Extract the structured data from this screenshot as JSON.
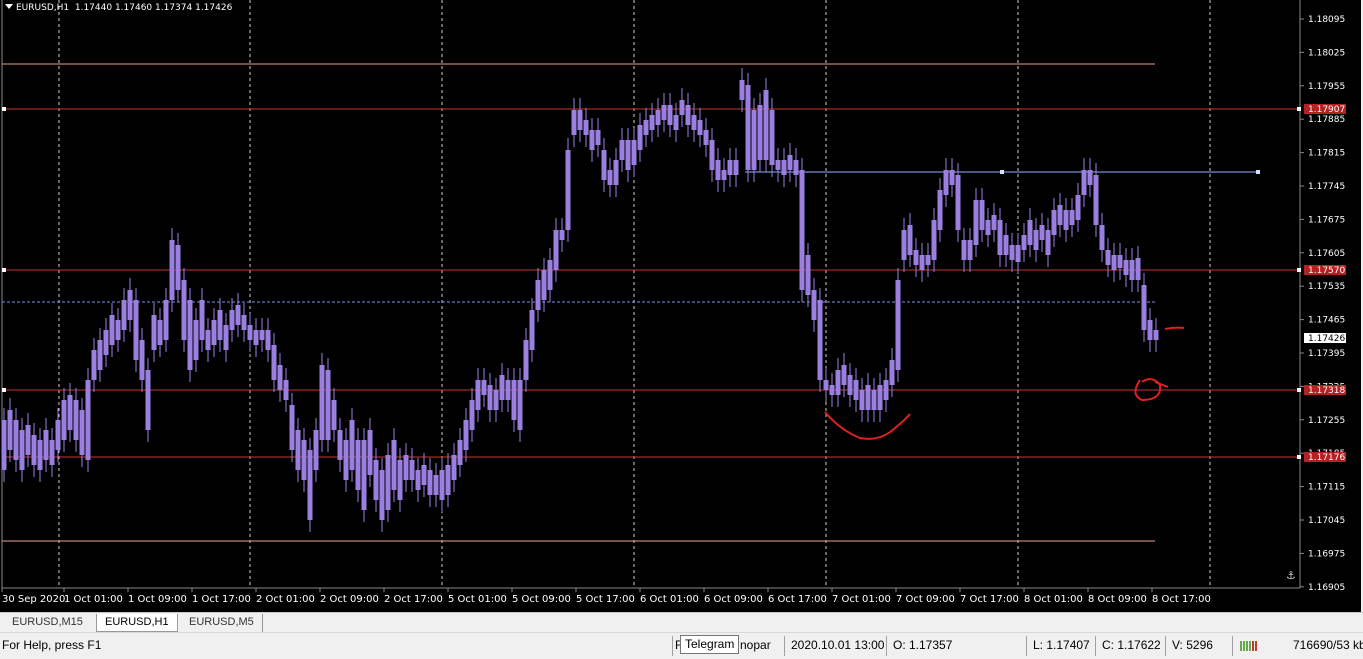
{
  "chart": {
    "symbol": "EURUSD,H1",
    "ohlc_text": "1.17440 1.17460 1.17374 1.17426",
    "current_price": "1.17426",
    "price_ticks": [
      "1.18095",
      "1.18025",
      "1.17955",
      "1.17885",
      "1.17815",
      "1.17745",
      "1.17675",
      "1.17605",
      "1.17535",
      "1.17465",
      "1.17395",
      "1.17325",
      "1.17255",
      "1.17185",
      "1.17115",
      "1.17045",
      "1.16975",
      "1.16905"
    ],
    "time_ticks": [
      "30 Sep 2020",
      "1 Oct 01:00",
      "1 Oct 09:00",
      "1 Oct 17:00",
      "2 Oct 01:00",
      "2 Oct 09:00",
      "2 Oct 17:00",
      "5 Oct 01:00",
      "5 Oct 09:00",
      "5 Oct 17:00",
      "6 Oct 01:00",
      "6 Oct 09:00",
      "6 Oct 17:00",
      "7 Oct 01:00",
      "7 Oct 09:00",
      "7 Oct 17:00",
      "8 Oct 01:00",
      "8 Oct 09:00",
      "8 Oct 17:00"
    ],
    "hline_labels": [
      "1.17907",
      "1.17570",
      "1.17318",
      "1.17176"
    ],
    "colors": {
      "candle": "#9b7fe0",
      "grid": "#cfcfcf",
      "hline": "#c0392b",
      "trendline": "#87b5ff",
      "label_bg": "#b22222"
    }
  },
  "tabs": [
    "EURUSD,M15",
    "EURUSD,H1",
    "EURUSD,M5"
  ],
  "status": {
    "help": "For Help, press F1",
    "tooltip": "Telegram",
    "profile_prefix": "F",
    "profile_suffix": "nopar",
    "datetime": "2020.10.01 13:00",
    "open": "O: 1.17357",
    "low": "L: 1.17407",
    "close": "C: 1.17622",
    "volume": "V: 5296",
    "traffic": "716690/53 kb"
  }
}
